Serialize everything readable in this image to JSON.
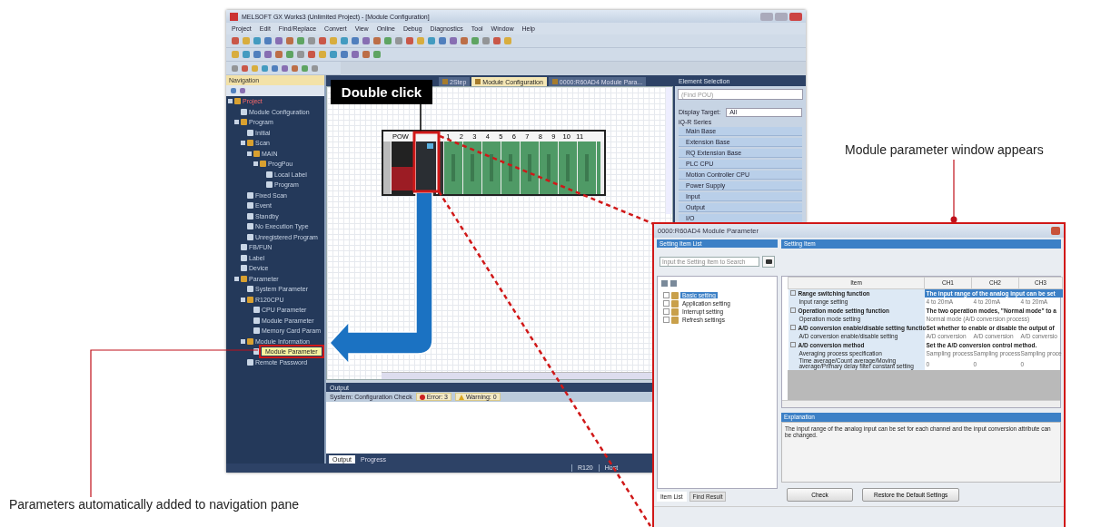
{
  "main_window": {
    "title": "MELSOFT GX Works3 (Unlimited Project) - [Module Configuration]",
    "menu": [
      "Project",
      "Edit",
      "Find/Replace",
      "Convert",
      "View",
      "Online",
      "Debug",
      "Diagnostics",
      "Tool",
      "Window",
      "Help"
    ],
    "navigation": {
      "title": "Navigation",
      "tree": [
        {
          "label": "Project",
          "selected": false,
          "children": [
            {
              "label": "Module Configuration",
              "selected": false
            },
            {
              "label": "Program",
              "selected": false,
              "children": [
                {
                  "label": "Initial",
                  "selected": false
                },
                {
                  "label": "Scan",
                  "selected": false,
                  "children": [
                    {
                      "label": "MAIN",
                      "selected": false,
                      "children": [
                        {
                          "label": "ProgPou",
                          "selected": false,
                          "children": [
                            {
                              "label": "Local Label",
                              "selected": false
                            },
                            {
                              "label": "Program",
                              "selected": false
                            }
                          ]
                        }
                      ]
                    }
                  ]
                },
                {
                  "label": "Fixed Scan",
                  "selected": false
                },
                {
                  "label": "Event",
                  "selected": false
                },
                {
                  "label": "Standby",
                  "selected": false
                },
                {
                  "label": "No Execution Type",
                  "selected": false
                },
                {
                  "label": "Unregistered Program",
                  "selected": false
                }
              ]
            },
            {
              "label": "FB/FUN",
              "selected": false
            },
            {
              "label": "Label",
              "selected": false
            },
            {
              "label": "Device",
              "selected": false
            },
            {
              "label": "Parameter",
              "selected": false,
              "children": [
                {
                  "label": "System Parameter",
                  "selected": false
                },
                {
                  "label": "R120CPU",
                  "selected": false,
                  "children": [
                    {
                      "label": "CPU Parameter",
                      "selected": false
                    },
                    {
                      "label": "Module Parameter",
                      "selected": false
                    },
                    {
                      "label": "Memory Card Param",
                      "selected": false
                    }
                  ]
                },
                {
                  "label": "Module Information",
                  "selected": false,
                  "children": [
                    {
                      "label": "Module Parameter",
                      "selected": true
                    }
                  ]
                },
                {
                  "label": "Remote Password",
                  "selected": false
                }
              ]
            }
          ]
        }
      ]
    },
    "tabs": [
      {
        "label": "2Step",
        "selected": false
      },
      {
        "label": "Module Configuration",
        "selected": true
      },
      {
        "label": "0000:R60AD4 Module Para...",
        "selected": false
      }
    ],
    "base_unit": {
      "slots": [
        "POW",
        "1",
        "2",
        "3",
        "4",
        "5",
        "6",
        "7",
        "8",
        "9",
        "10",
        "11"
      ]
    },
    "element_selection": {
      "title": "Element Selection",
      "search_placeholder": "(Find POU)",
      "display_target_label": "Display Target:",
      "display_target": "All",
      "category": "iQ-R Series",
      "items": [
        "Main Base",
        "Extension Base",
        "RQ Extension Base",
        "PLC CPU",
        "Motion Controller CPU",
        "Power Supply",
        "Input",
        "Output",
        "I/O"
      ]
    },
    "output": {
      "title": "Output",
      "check_label": "System: Configuration Check",
      "error": "Error: 3",
      "warning": "Warning: 0",
      "tabs": [
        {
          "label": "Output",
          "selected": true
        },
        {
          "label": "Progress",
          "selected": false
        }
      ]
    },
    "status_bar": [
      "R120",
      "Host"
    ]
  },
  "dialog": {
    "title": "0000:R60AD4 Module Parameter",
    "list_header": "Setting Item List",
    "search_placeholder": "Input the Setting Item to Search",
    "tree": [
      {
        "label": "Basic setting",
        "selected": true
      },
      {
        "label": "Application setting",
        "selected": false
      },
      {
        "label": "Interrupt setting",
        "selected": false
      },
      {
        "label": "Refresh settings",
        "selected": false
      }
    ],
    "list_tabs": [
      {
        "label": "Item List",
        "selected": true
      },
      {
        "label": "Find Result",
        "selected": false
      }
    ],
    "setting_header": "Setting Item",
    "table": {
      "columns": [
        "Item",
        "CH1",
        "CH2",
        "CH3"
      ],
      "rows": [
        {
          "kind": "group",
          "item": "Range switching function",
          "description": "The input range of the analog input can be set",
          "selected": true
        },
        {
          "kind": "setting",
          "item": "Input range setting",
          "values": [
            "4 to 20mA",
            "4 to 20mA",
            "4 to 20mA"
          ],
          "selected": false
        },
        {
          "kind": "group",
          "item": "Operation mode setting function",
          "description": "The two operation modes, \"Normal mode\" to a",
          "selected": false
        },
        {
          "kind": "setting",
          "item": "Operation mode setting",
          "values": [
            "Normal mode (A/D conversion process)"
          ],
          "selected": false
        },
        {
          "kind": "group",
          "item": "A/D conversion enable/disable setting functio",
          "description": "Set whether to enable or disable the output of",
          "selected": false
        },
        {
          "kind": "setting",
          "item": "A/D conversion enable/disable setting",
          "values": [
            "A/D conversion",
            "A/D conversion",
            "A/D conversio"
          ],
          "selected": false
        },
        {
          "kind": "group",
          "item": "A/D conversion method",
          "description": "Set the A/D conversion control method.",
          "selected": false
        },
        {
          "kind": "setting",
          "item": "Averaging process specification",
          "values": [
            "Sampling process",
            "Sampling process",
            "Sampling proce"
          ],
          "selected": false
        },
        {
          "kind": "setting",
          "item": "Time average/Count average/Moving average/Primary delay filter constant setting",
          "values": [
            "0",
            "0",
            "0"
          ],
          "selected": false
        }
      ]
    },
    "explanation_header": "Explanation",
    "explanation": "The input range of the analog input can be set for each channel and the input conversion attribute can be changed.",
    "buttons": [
      "Check",
      "Restore the Default Settings"
    ]
  },
  "annotations": {
    "double_click": "Double click",
    "window_appears": "Module parameter window appears",
    "added_to_navigation": "Parameters automatically added to navigation pane"
  }
}
